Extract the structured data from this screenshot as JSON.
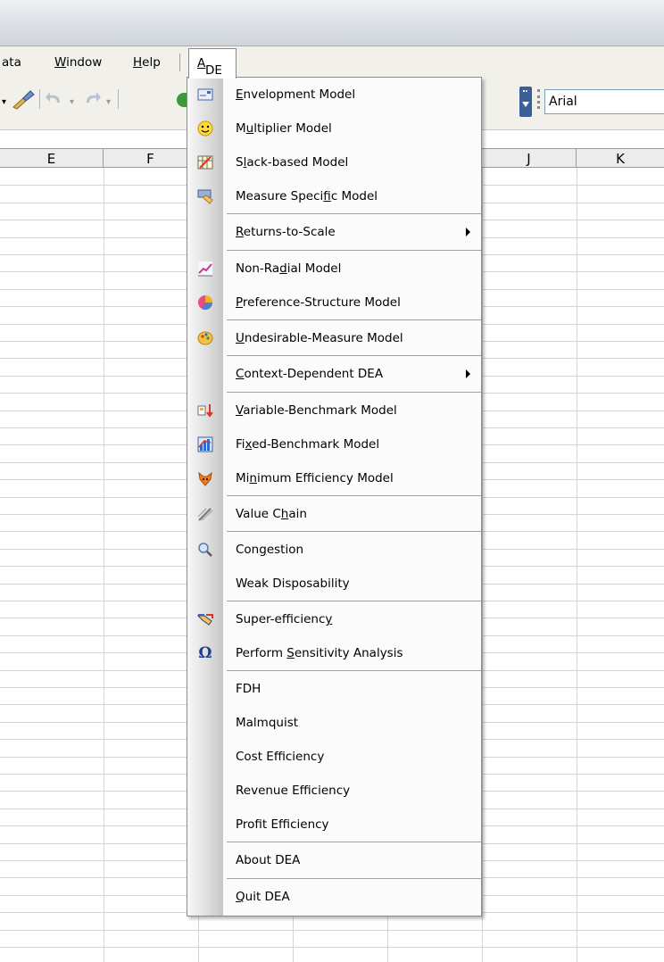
{
  "menubar": {
    "items": [
      {
        "text": "ata",
        "u": ""
      },
      {
        "text": "indow",
        "u": "W"
      },
      {
        "text": "elp",
        "u": "H"
      }
    ],
    "dea": {
      "pre": "DE",
      "u": "A"
    }
  },
  "toolbar": {
    "font_name": "Arial"
  },
  "columns": [
    "E",
    "F",
    "",
    "",
    "",
    "J",
    "K"
  ],
  "dea_menu": [
    {
      "pre": "",
      "u": "E",
      "post": "nvelopment Model",
      "icon": "envelopment-icon"
    },
    {
      "pre": "M",
      "u": "u",
      "post": "ltiplier Model",
      "icon": "smiley-icon"
    },
    {
      "pre": "S",
      "u": "l",
      "post": "ack-based Model",
      "icon": "calculator-icon"
    },
    {
      "pre": "Measure Speci",
      "u": "f",
      "post": "ic Model",
      "icon": "hand-card-icon"
    },
    {
      "pre": "",
      "u": "R",
      "post": "eturns-to-Scale",
      "icon": "",
      "submenu": true
    },
    {
      "pre": "Non-Ra",
      "u": "d",
      "post": "ial Model",
      "icon": "line-chart-icon"
    },
    {
      "pre": "",
      "u": "P",
      "post": "reference-Structure Model",
      "icon": "pie-chart-icon"
    },
    {
      "pre": "",
      "u": "U",
      "post": "ndesirable-Measure Model",
      "icon": "palette-icon"
    },
    {
      "pre": "",
      "u": "C",
      "post": "ontext-Dependent DEA",
      "icon": "",
      "submenu": true
    },
    {
      "pre": "",
      "u": "V",
      "post": "ariable-Benchmark Model",
      "icon": "sort-down-icon"
    },
    {
      "pre": "Fi",
      "u": "x",
      "post": "ed-Benchmark Model",
      "icon": "bar-chart-icon"
    },
    {
      "pre": "Mi",
      "u": "n",
      "post": "imum Efficiency Model",
      "icon": "fox-icon"
    },
    {
      "pre": "Value C",
      "u": "h",
      "post": "ain",
      "icon": "pen-icon"
    },
    {
      "pre": "Con",
      "u": "g",
      "post": "estion",
      "icon": "magnifier-icon"
    },
    {
      "pre": "Weak Disposability",
      "u": "",
      "post": "",
      "icon": ""
    },
    {
      "pre": "Super-efficienc",
      "u": "y",
      "post": "",
      "icon": "handshake-icon"
    },
    {
      "pre": "Perform ",
      "u": "S",
      "post": "ensitivity Analysis",
      "icon": "omega-icon"
    },
    {
      "pre": "FDH",
      "u": "",
      "post": "",
      "icon": ""
    },
    {
      "pre": "Malmquist",
      "u": "",
      "post": "",
      "icon": ""
    },
    {
      "pre": "Cost Efficiency",
      "u": "",
      "post": "",
      "icon": ""
    },
    {
      "pre": "Revenue Efficiency",
      "u": "",
      "post": "",
      "icon": ""
    },
    {
      "pre": "Profit Efficiency",
      "u": "",
      "post": "",
      "icon": ""
    },
    {
      "pre": "About DEA",
      "u": "",
      "post": "",
      "icon": ""
    },
    {
      "pre": "",
      "u": "Q",
      "post": "uit DEA",
      "icon": ""
    }
  ],
  "omega_glyph": "Ω"
}
